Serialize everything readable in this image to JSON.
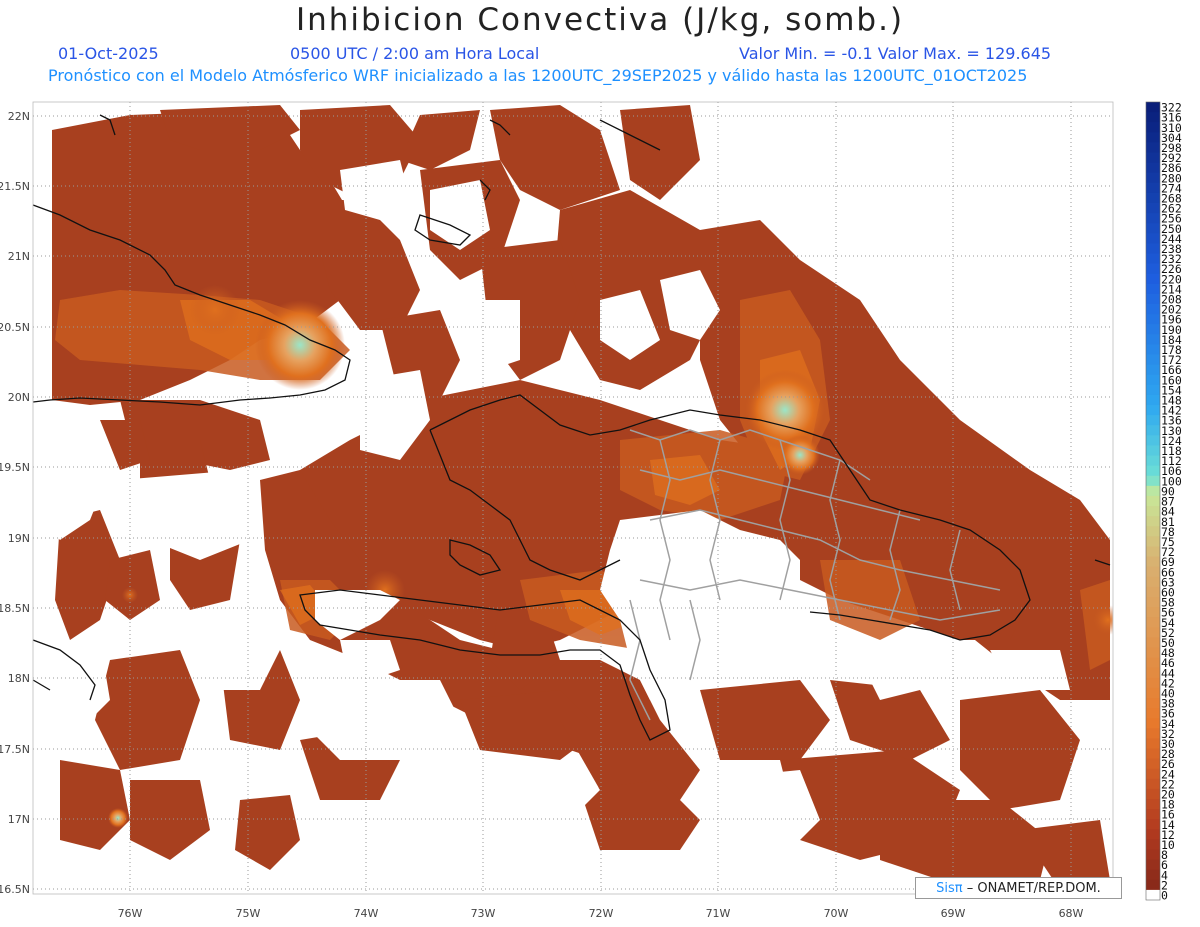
{
  "header": {
    "title": "Inhibicion Convectiva (J/kg, somb.)",
    "date": "01-Oct-2025",
    "time": "0500 UTC / 2:00 am Hora Local",
    "minmax": "Valor Min. = -0.1  Valor Max. = 129.645",
    "subtitle": "Pronóstico con el Modelo Atmósferico WRF inicializado a las 1200UTC_29SEP2025 y válido hasta las  1200UTC_01OCT2025"
  },
  "credit": {
    "prefix": "Sisπ",
    "suffix": "– ONAMET/REP.DOM."
  },
  "axes": {
    "lat_labels": [
      "22N",
      "21.5N",
      "21N",
      "20.5N",
      "20N",
      "19.5N",
      "19N",
      "18.5N",
      "18N",
      "17.5N",
      "17N",
      "16.5N"
    ],
    "lon_labels": [
      "76W",
      "75W",
      "74W",
      "73W",
      "72W",
      "71W",
      "70W",
      "69W",
      "68W"
    ]
  },
  "colorbar": {
    "labels": [
      "322",
      "316",
      "310",
      "304",
      "298",
      "292",
      "286",
      "280",
      "274",
      "268",
      "262",
      "256",
      "250",
      "244",
      "238",
      "232",
      "226",
      "220",
      "214",
      "208",
      "202",
      "196",
      "190",
      "184",
      "178",
      "172",
      "166",
      "160",
      "154",
      "148",
      "142",
      "136",
      "130",
      "124",
      "118",
      "112",
      "106",
      "100",
      "90",
      "87",
      "84",
      "81",
      "78",
      "75",
      "72",
      "69",
      "66",
      "63",
      "60",
      "58",
      "56",
      "54",
      "52",
      "50",
      "48",
      "46",
      "44",
      "42",
      "40",
      "38",
      "36",
      "34",
      "32",
      "30",
      "28",
      "26",
      "24",
      "22",
      "20",
      "18",
      "16",
      "14",
      "12",
      "10",
      "8",
      "6",
      "4",
      "2",
      "0"
    ],
    "colors": {
      "dark_blue": "#0a1f7a",
      "blue": "#1e5fe0",
      "light_blue": "#2fa8f0",
      "cyan": "#6ee0d6",
      "light_green": "#c8e89a",
      "tan": "#d9b070",
      "orange": "#e87a2c",
      "red_brown": "#b13a1f",
      "dark_brown": "#8a2a1a",
      "zero": "#ffffff"
    }
  },
  "field_colors": {
    "base": "#a8401f",
    "mid": "#c85a20",
    "hot": "#e0701e",
    "peak": "#9be6c8",
    "border_country": "#111111",
    "border_province": "#a0a0a0"
  }
}
